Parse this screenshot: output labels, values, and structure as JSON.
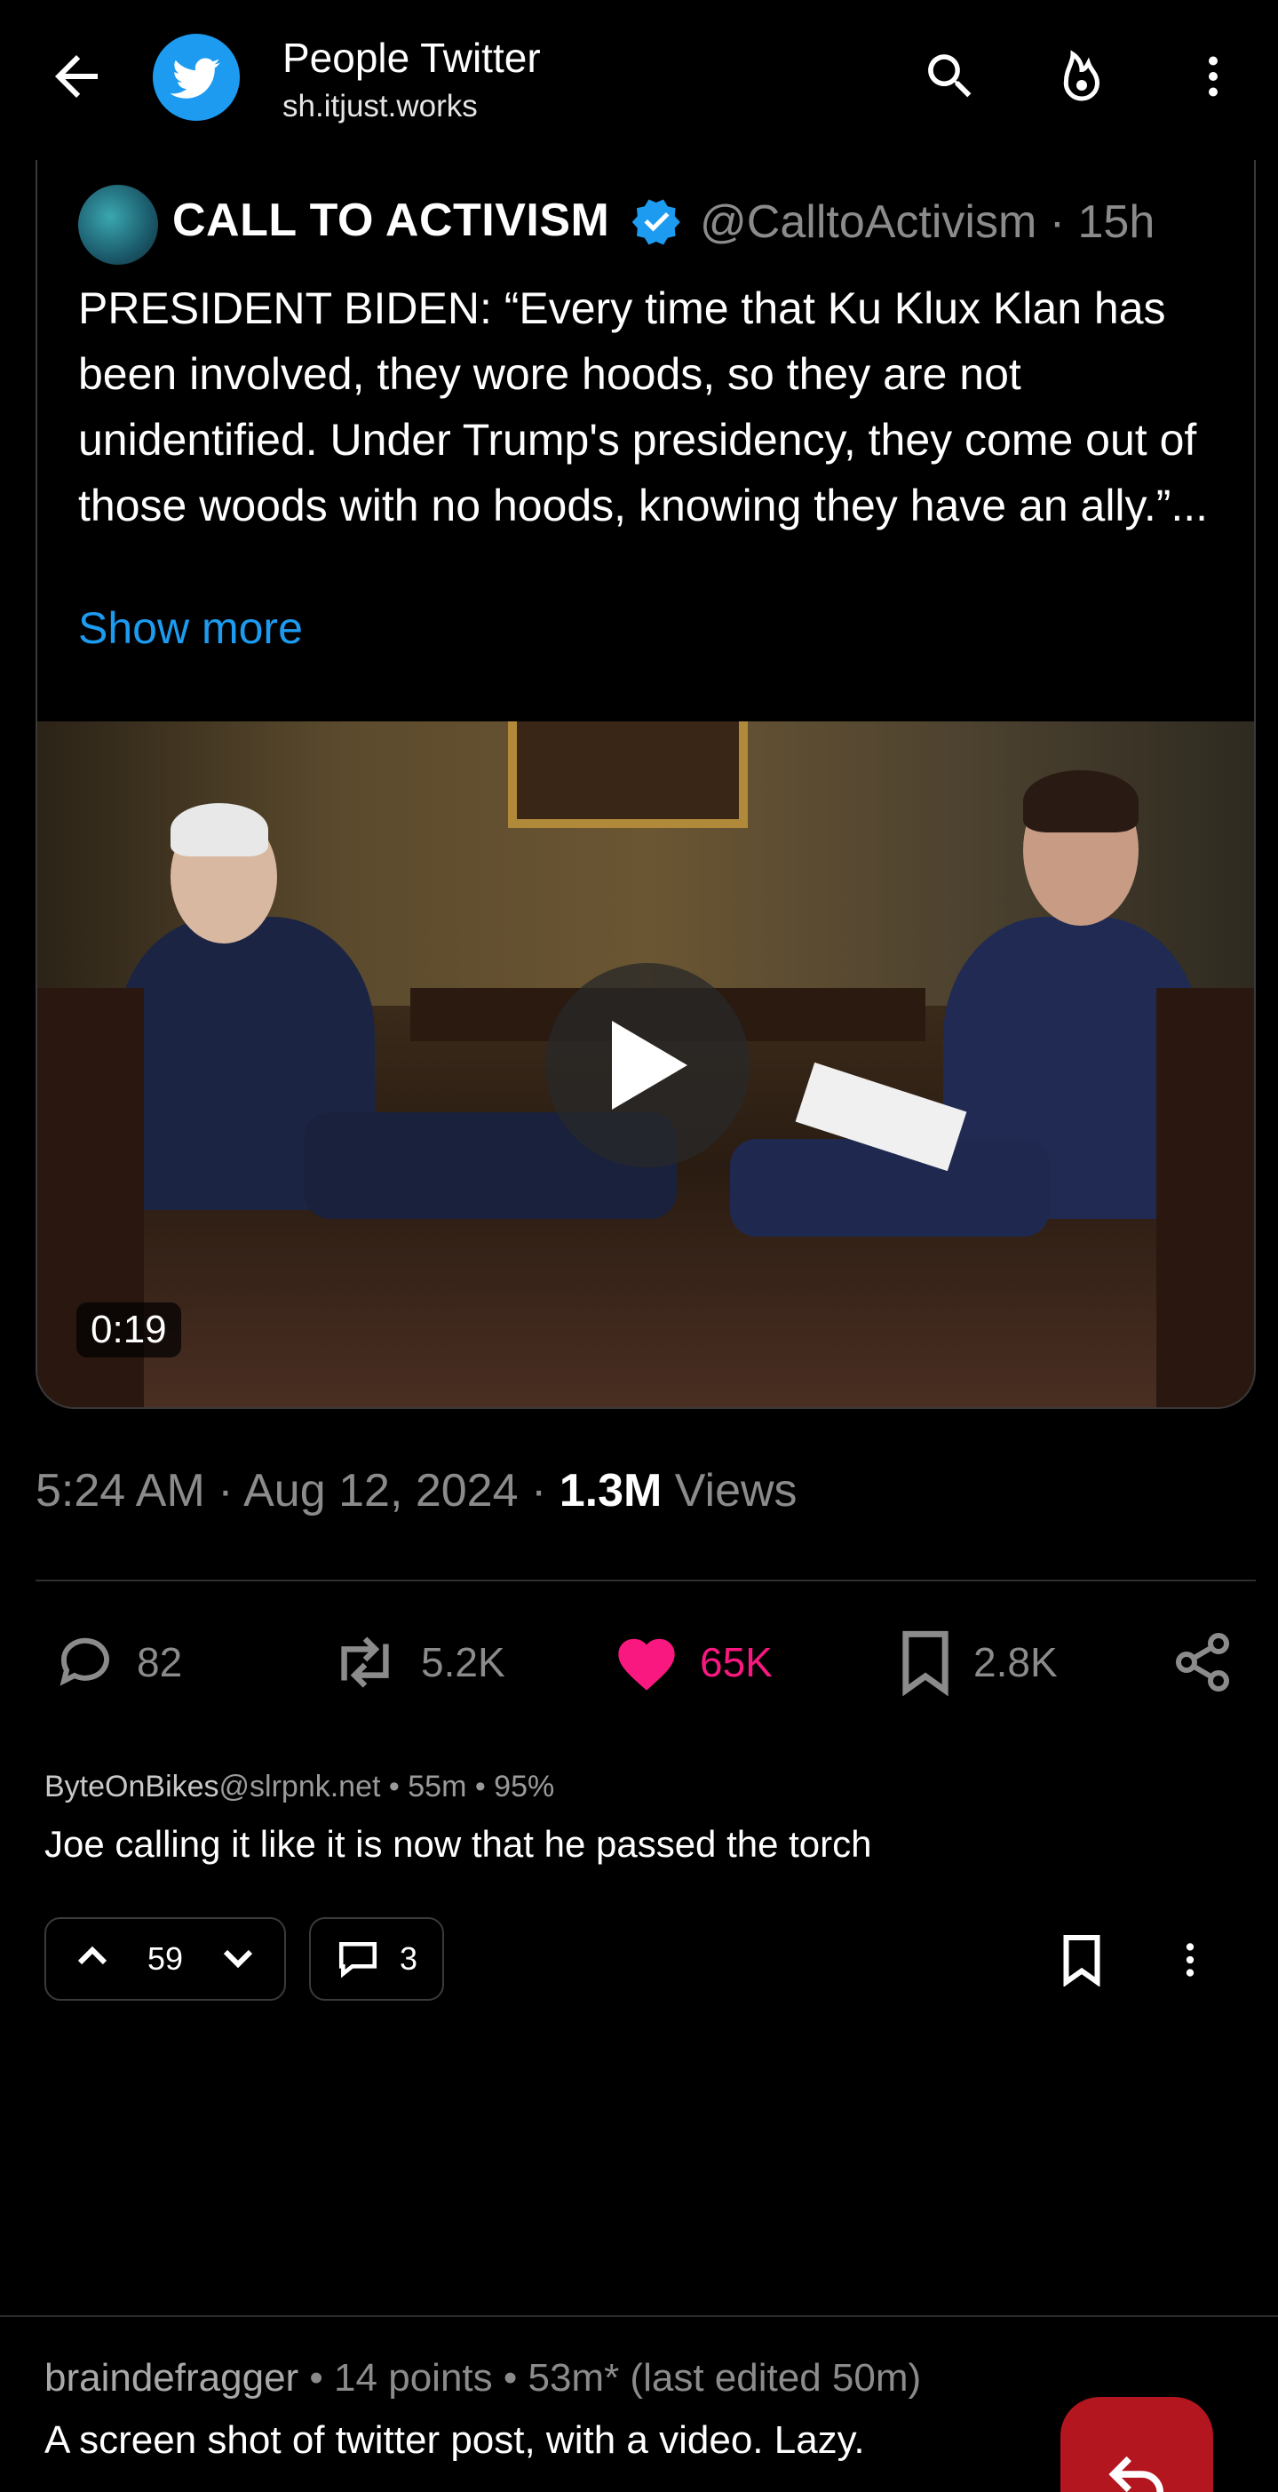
{
  "topbar": {
    "community_name": "People Twitter",
    "community_host": "sh.itjust.works",
    "icons": [
      "back-arrow-icon",
      "twitter-bird-icon",
      "search-icon",
      "hot-flame-icon",
      "more-vert-icon"
    ]
  },
  "tweet": {
    "author_name": "CALL TO ACTIVISM",
    "handle_time": "@CalltoActivism · 15h",
    "body": "PRESIDENT BIDEN: “Every time that Ku Klux Klan has been involved, they wore hoods, so they are not unidentified. Under Trump's presidency, they come out of those woods with no hoods, knowing they have an ally.”...",
    "show_more": "Show more",
    "video_duration": "0:19",
    "meta_time": "5:24 AM · Aug 12, 2024 · ",
    "meta_views": "1.3M",
    "meta_views_label": " Views",
    "stats": {
      "replies": "82",
      "retweets": "5.2K",
      "likes": "65K",
      "bookmarks": "2.8K"
    },
    "colors": {
      "like": "#f91880",
      "link": "#1d9bf0",
      "muted": "#8b8b8b"
    }
  },
  "comment1": {
    "author": "ByteOnBikes",
    "instance": "@slrpnk.net",
    "meta": " • 55m • 95%",
    "text": "Joe calling it like it is now that he passed the torch",
    "score": "59",
    "replies": "3"
  },
  "comment2": {
    "author": "braindefragger",
    "meta": " • 14 points • 53m* (last edited 50m)",
    "text": "A screen shot of twitter post, with a video. Lazy."
  },
  "fab_color": "#b3161e"
}
